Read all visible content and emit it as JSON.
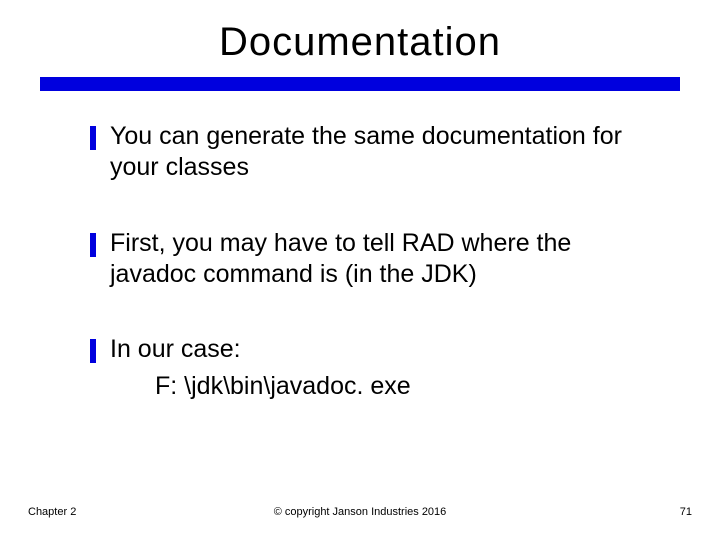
{
  "title": "Documentation",
  "bullets": [
    {
      "text": "You can generate the same documentation for your classes"
    },
    {
      "text": "First, you may have to tell RAD where the javadoc command is (in the JDK)"
    },
    {
      "text": "In our case:",
      "sub": "F: \\jdk\\bin\\javadoc. exe"
    }
  ],
  "footer": {
    "left": "Chapter 2",
    "center": "© copyright Janson Industries 2016",
    "right": "71"
  }
}
